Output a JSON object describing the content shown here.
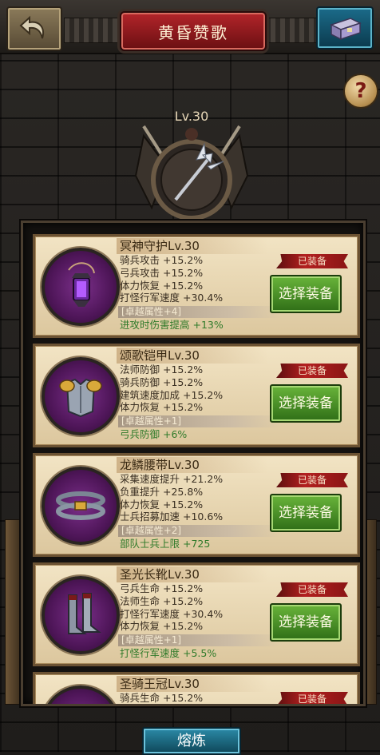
{
  "header": {
    "title": "黄昏赞歌"
  },
  "hero": {
    "level": "Lv.30"
  },
  "help": {
    "symbol": "?"
  },
  "items": [
    {
      "name": "冥神守护Lv.30",
      "icon": "lantern-icon",
      "status": "已装备",
      "stats": [
        "骑兵攻击 +15.2%",
        "弓兵攻击 +15.2%",
        "体力恢复 +15.2%",
        "打怪行军速度 +30.4%"
      ],
      "bonus_head": "卓越属性+4",
      "bonus": "进攻时伤害提高 +13%",
      "button": "选择装备"
    },
    {
      "name": "颂歌铠甲Lv.30",
      "icon": "armor-icon",
      "status": "已装备",
      "stats": [
        "法师防御 +15.2%",
        "骑兵防御 +15.2%",
        "建筑速度加成 +15.2%",
        "体力恢复 +15.2%"
      ],
      "bonus_head": "卓越属性+1",
      "bonus": "弓兵防御 +6%",
      "button": "选择装备"
    },
    {
      "name": "龙鳞腰带Lv.30",
      "icon": "belt-icon",
      "status": "已装备",
      "stats": [
        "采集速度提升 +21.2%",
        "负重提升 +25.8%",
        "体力恢复 +15.2%",
        "士兵招募加速 +10.6%"
      ],
      "bonus_head": "卓越属性+2",
      "bonus": "部队士兵上限 +725",
      "button": "选择装备"
    },
    {
      "name": "圣光长靴Lv.30",
      "icon": "boots-icon",
      "status": "已装备",
      "stats": [
        "弓兵生命 +15.2%",
        "法师生命 +15.2%",
        "打怪行军速度 +30.4%",
        "体力恢复 +15.2%"
      ],
      "bonus_head": "卓越属性+1",
      "bonus": "打怪行军速度 +5.5%",
      "button": "选择装备"
    },
    {
      "name": "圣骑王冠Lv.30",
      "icon": "crown-icon",
      "status": "已装备",
      "stats": [
        "骑兵生命 +15.2%"
      ],
      "bonus_head": "",
      "bonus": "",
      "button": ""
    }
  ],
  "footer": {
    "smelt_label": "熔炼"
  },
  "colors": {
    "accent_red": "#b3252a",
    "button_green": "#4f9a2a",
    "bonus_green": "#2f7a2a"
  }
}
